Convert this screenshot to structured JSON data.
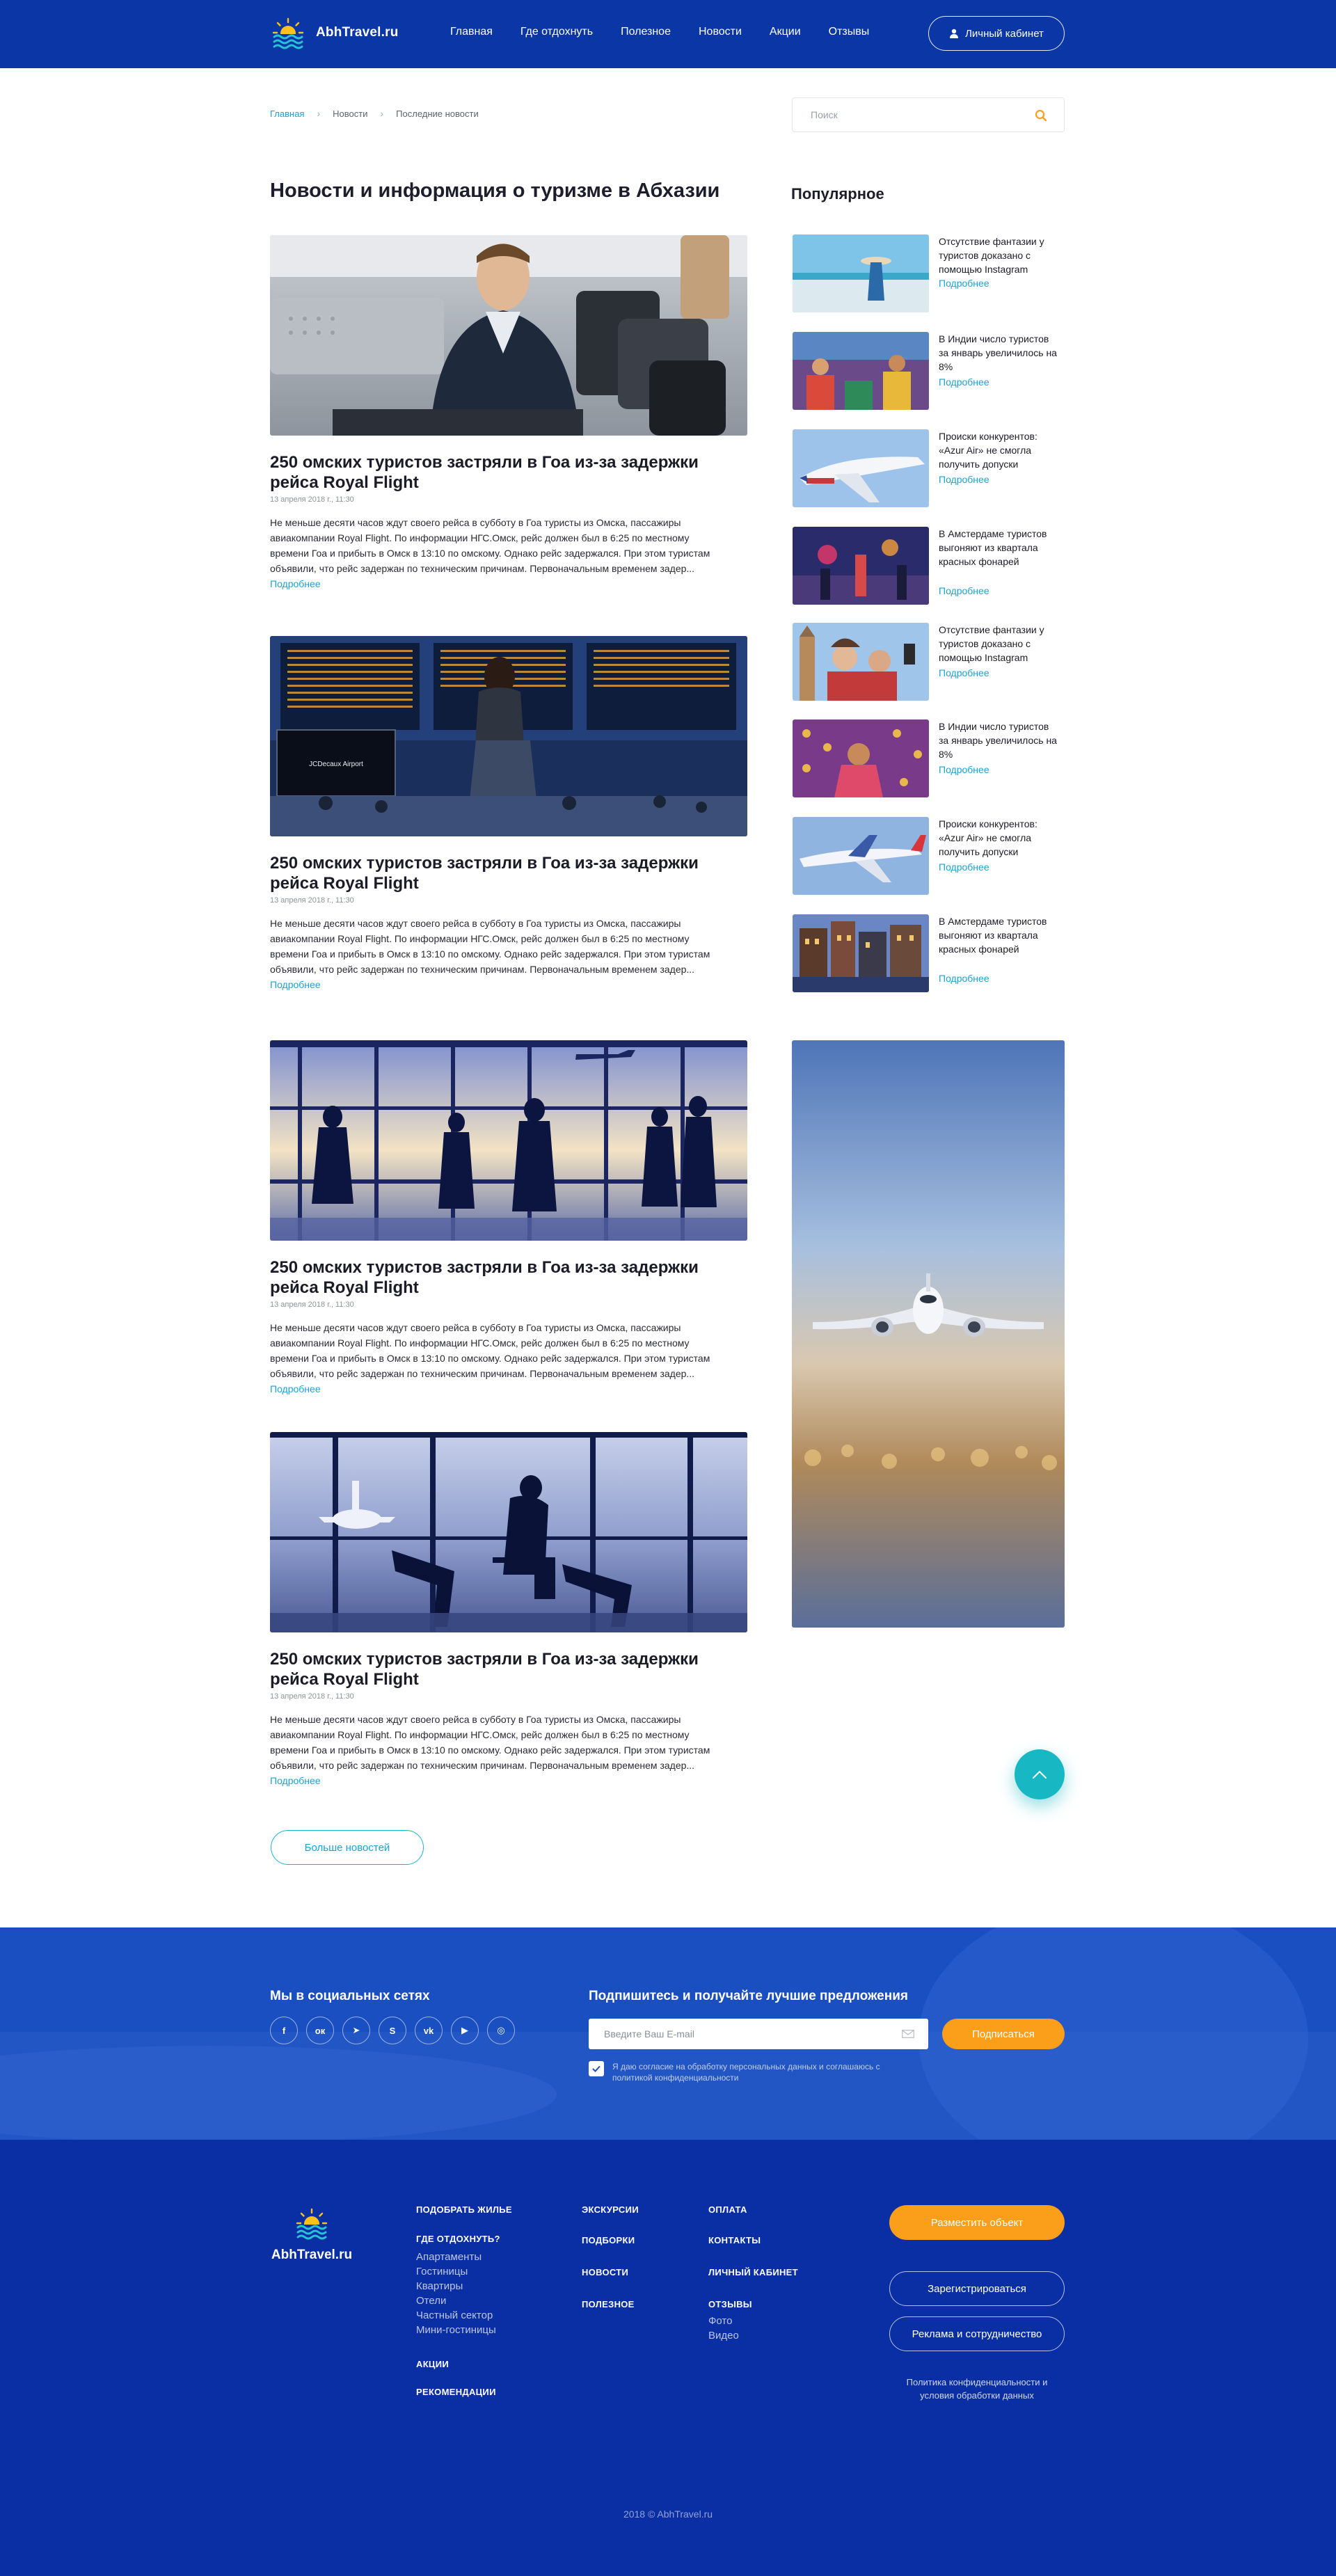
{
  "header": {
    "logo_text": "AbhTravel.ru",
    "nav": [
      "Главная",
      "Где отдохнуть",
      "Полезное",
      "Новости",
      "Акции",
      "Отзывы"
    ],
    "cabinet_label": "Личный кабинет"
  },
  "breadcrumb": [
    "Главная",
    "Новости",
    "Последние новости"
  ],
  "search": {
    "placeholder": "Поиск"
  },
  "page_title": "Новости и информация о туризме в Абхазии",
  "popular_title": "Популярное",
  "articles": [
    {
      "title": "250 омских туристов застряли в Гоа из-за задержки рейса Royal Flight",
      "date": "13 апреля 2018 г., 11:30",
      "text": "Не меньше десяти часов ждут своего рейса в субботу в Гоа туристы из Омска, пассажиры авиакомпании Royal Flight. По информации НГС.Омск, рейс должен был в 6:25 по местному времени Гоа и прибыть в Омск в 13:10 по омскому. Однако рейс задержался. При этом туристам объявили, что рейс задержан по техническим причинам. Первоначальным временем задер...",
      "more": "Подробнее"
    },
    {
      "title": "250 омских туристов застряли в Гоа из-за задержки рейса Royal Flight",
      "date": "13 апреля 2018 г., 11:30",
      "text": "Не меньше десяти часов ждут своего рейса в субботу в Гоа туристы из Омска, пассажиры авиакомпании Royal Flight. По информации НГС.Омск, рейс должен был в 6:25 по местному времени Гоа и прибыть в Омск в 13:10 по омскому. Однако рейс задержался. При этом туристам объявили, что рейс задержан по техническим причинам. Первоначальным временем задер...",
      "more": "Подробнее",
      "screen_text": "JCDecaux Airport"
    },
    {
      "title": "250 омских туристов застряли в Гоа из-за задержки рейса Royal Flight",
      "date": "13 апреля 2018 г., 11:30",
      "text": "Не меньше десяти часов ждут своего рейса в субботу в Гоа туристы из Омска, пассажиры авиакомпании Royal Flight. По информации НГС.Омск, рейс должен был в 6:25 по местному времени Гоа и прибыть в Омск в 13:10 по омскому. Однако рейс задержался. При этом туристам объявили, что рейс задержан по техническим причинам. Первоначальным временем задер...",
      "more": "Подробнее"
    },
    {
      "title": "250 омских туристов застряли в Гоа из-за задержки рейса Royal Flight",
      "date": "13 апреля 2018 г., 11:30",
      "text": "Не меньше десяти часов ждут своего рейса в субботу в Гоа туристы из Омска, пассажиры авиакомпании Royal Flight. По информации НГС.Омск, рейс должен был в 6:25 по местному времени Гоа и прибыть в Омск в 13:10 по омскому. Однако рейс задержался. При этом туристам объявили, что рейс задержан по техническим причинам. Первоначальным временем задер...",
      "more": "Подробнее"
    }
  ],
  "more_news": "Больше новостей",
  "popular": [
    {
      "text": "Отсутствие фантазии у туристов доказано с помощью Instagram",
      "more": "Подробнее"
    },
    {
      "text": "В Индии число туристов за январь увеличилось на 8%",
      "more": "Подробнее"
    },
    {
      "text": "Происки конкурентов: «Azur Air» не смогла получить допуски",
      "more": "Подробнее"
    },
    {
      "text": "В Амстердаме туристов выгоняют из квартала красных фонарей",
      "more": "Подробнее"
    },
    {
      "text": "Отсутствие фантазии у туристов доказано с помощью Instagram",
      "more": "Подробнее"
    },
    {
      "text": "В Индии число туристов за январь увеличилось на 8%",
      "more": "Подробнее"
    },
    {
      "text": "Происки конкурентов: «Azur Air» не смогла получить допуски",
      "more": "Подробнее"
    },
    {
      "text": "В Амстердаме туристов выгоняют из квартала красных фонарей",
      "more": "Подробнее"
    }
  ],
  "subscribe": {
    "social_title": "Мы в социальных сетях",
    "social_icons": [
      "facebook-icon",
      "odnoklassniki-icon",
      "telegram-icon",
      "skype-icon",
      "vk-icon",
      "youtube-icon",
      "instagram-icon"
    ],
    "social_glyphs": [
      "f",
      "ок",
      "➤",
      "S",
      "vk",
      "▶",
      "◎"
    ],
    "title": "Подпишитесь и получайте лучшие предложения",
    "email_placeholder": "Введите Ваш E-mail",
    "button": "Подписаться",
    "consent": "Я даю согласие на обработку персональных данных и соглашаюсь с политикой конфиденциальности"
  },
  "footer": {
    "logo_text": "AbhTravel.ru",
    "col1": {
      "head1": "ПОДОБРАТЬ ЖИЛЬЕ",
      "head2": "ГДЕ ОТДОХНУТЬ?",
      "items": [
        "Апартаменты",
        "Гостиницы",
        "Квартиры",
        "Отели",
        "Частный сектор",
        "Мини-гостиницы"
      ],
      "head3": "АКЦИИ",
      "head4": "РЕКОМЕНДАЦИИ"
    },
    "col2": [
      "ЭКСКУРСИИ",
      "ПОДБОРКИ",
      "НОВОСТИ",
      "ПОЛЕЗНОЕ"
    ],
    "col3": {
      "heads": [
        "ОПЛАТА",
        "КОНТАКТЫ",
        "ЛИЧНЫЙ КАБИНЕТ",
        "ОТЗЫВЫ"
      ],
      "items": [
        "Фото",
        "Видео"
      ]
    },
    "place_object": "Разместить объект",
    "register": "Зарегистрироваться",
    "ads": "Реклама и сотрудничество",
    "policy": "Политика конфиденциальности и условия обработки данных",
    "copyright": "2018 © AbhTravel.ru"
  },
  "colors": {
    "header_blue": "#0a37a5",
    "footer_blue": "#0a2fa4",
    "accent_orange": "#fb9e1a",
    "link_blue": "#1aa3d6",
    "teal": "#17b8c4"
  }
}
